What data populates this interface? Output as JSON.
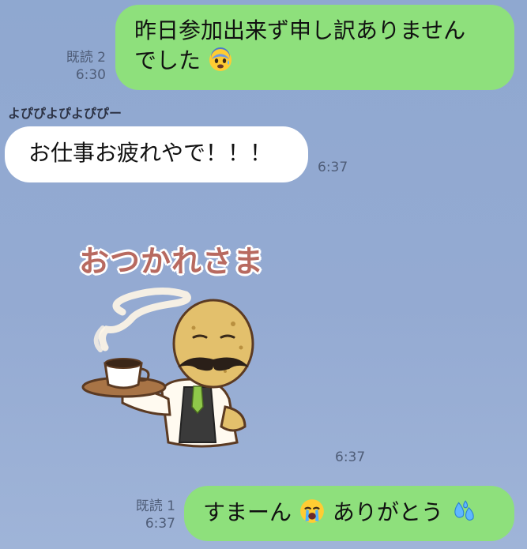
{
  "messages": {
    "out1": {
      "line1": "昨日参加出来ず申し訳ありません",
      "line2": "でした",
      "emoji": "fearful-sweat-emoji",
      "read": "既読 2",
      "time": "6:30"
    },
    "in1": {
      "sender": "よぴぴよぴよぴぴー",
      "text": "お仕事お疲れやで！！！",
      "time": "6:37"
    },
    "sticker": {
      "title": "おつかれさま",
      "time": "6:37"
    },
    "out2": {
      "text1": "すまーん",
      "emoji1": "crying-face-emoji",
      "text2": "ありがとう",
      "emoji2": "sweat-droplets-emoji",
      "read": "既読 1",
      "time": "6:37"
    }
  },
  "colors": {
    "background": "#94aad2",
    "outgoing_bubble": "#8ee07c",
    "incoming_bubble": "#ffffff"
  }
}
